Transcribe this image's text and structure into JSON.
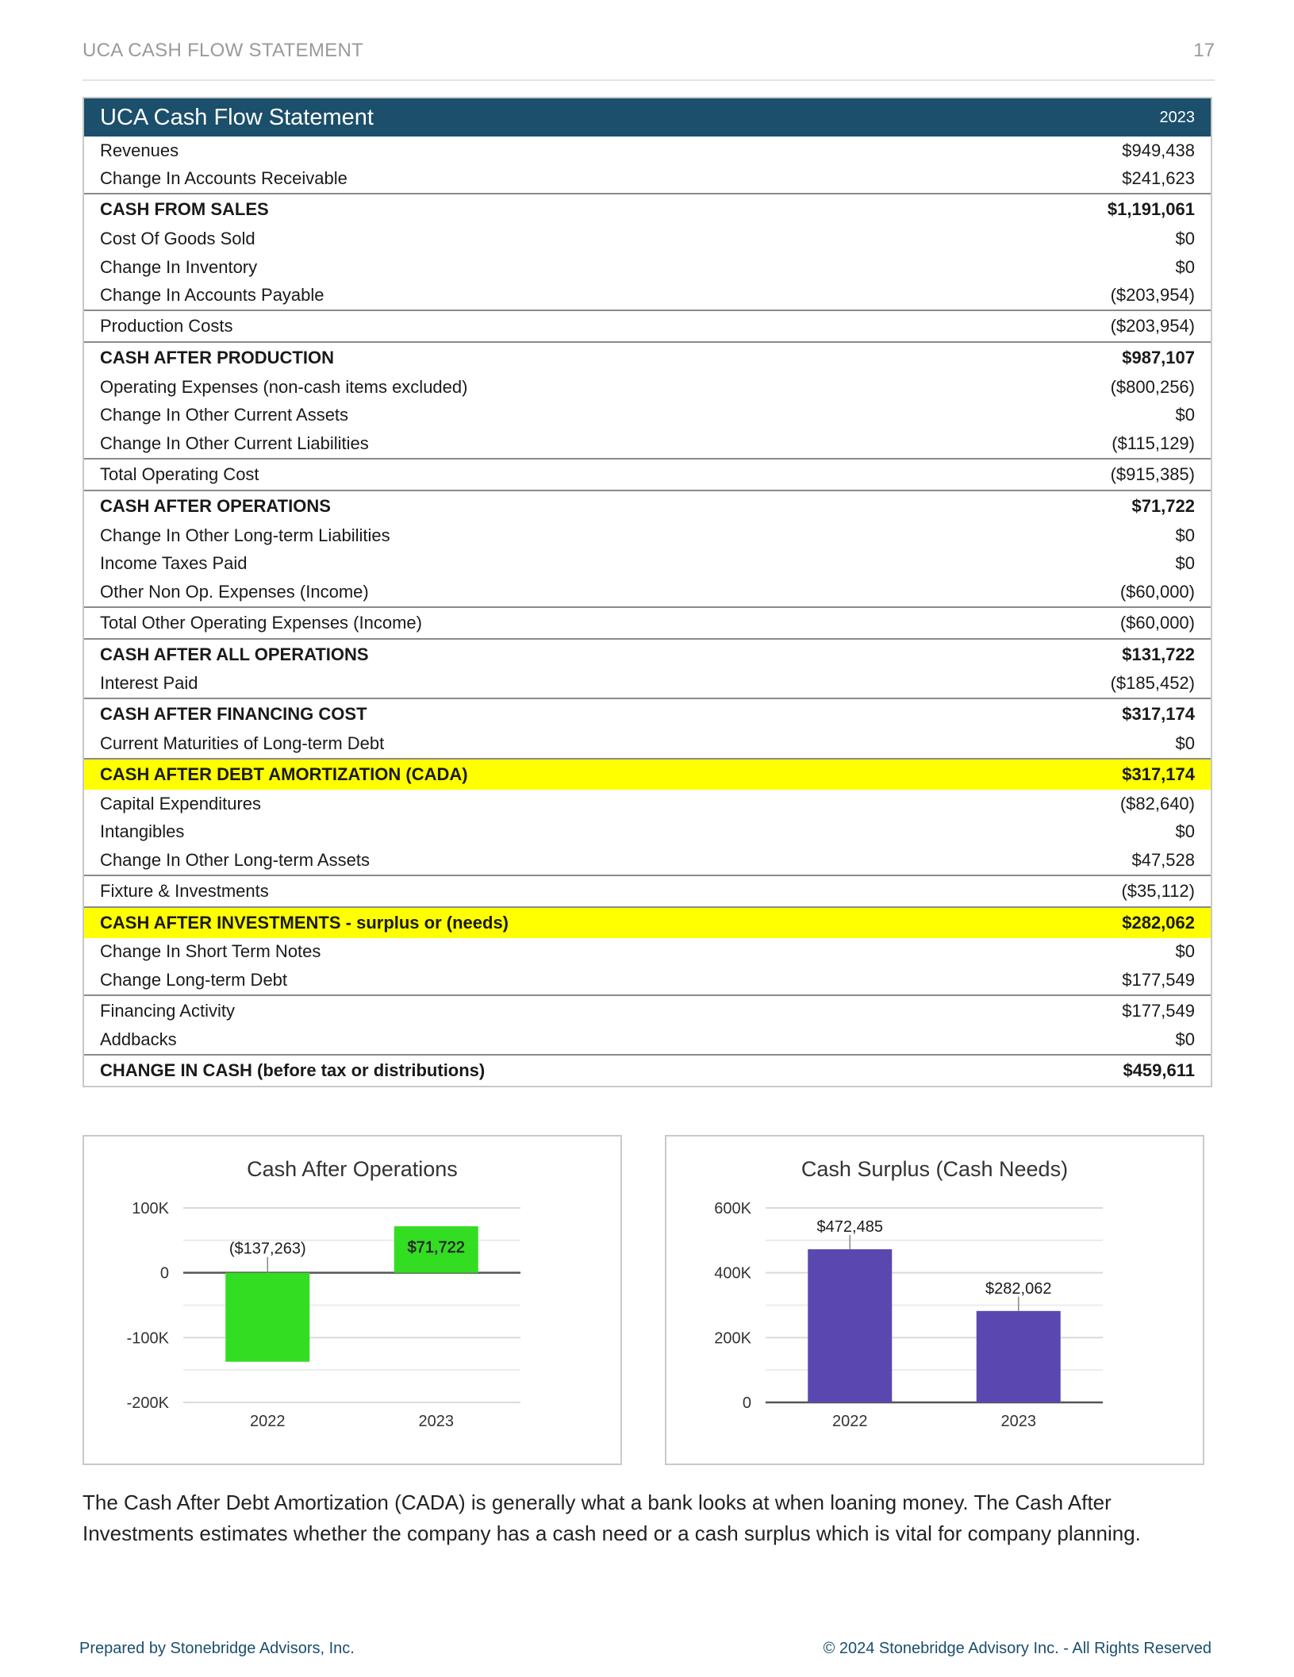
{
  "header": {
    "title": "UCA CASH FLOW STATEMENT",
    "page": "17"
  },
  "statement": {
    "title": "UCA Cash Flow Statement",
    "year": "2023",
    "rows": [
      {
        "label": "Revenues",
        "value": "$949,438",
        "style": ""
      },
      {
        "label": "Change In Accounts Receivable",
        "value": "$241,623",
        "style": ""
      },
      {
        "label": "CASH FROM SALES",
        "value": "$1,191,061",
        "style": "t b"
      },
      {
        "label": "Cost Of Goods Sold",
        "value": "$0",
        "style": ""
      },
      {
        "label": "Change In Inventory",
        "value": "$0",
        "style": ""
      },
      {
        "label": "Change In Accounts Payable",
        "value": "($203,954)",
        "style": ""
      },
      {
        "label": "Production Costs",
        "value": "($203,954)",
        "style": "t"
      },
      {
        "label": "CASH AFTER PRODUCTION",
        "value": "$987,107",
        "style": "t b"
      },
      {
        "label": "Operating Expenses (non-cash items excluded)",
        "value": "($800,256)",
        "style": ""
      },
      {
        "label": "Change In Other Current Assets",
        "value": "$0",
        "style": ""
      },
      {
        "label": "Change In Other Current Liabilities",
        "value": "($115,129)",
        "style": ""
      },
      {
        "label": "Total Operating Cost",
        "value": "($915,385)",
        "style": "t"
      },
      {
        "label": "CASH AFTER OPERATIONS",
        "value": "$71,722",
        "style": "t b"
      },
      {
        "label": "Change In Other Long-term Liabilities",
        "value": "$0",
        "style": ""
      },
      {
        "label": "Income Taxes Paid",
        "value": "$0",
        "style": ""
      },
      {
        "label": "Other Non Op. Expenses (Income)",
        "value": "($60,000)",
        "style": ""
      },
      {
        "label": "Total Other Operating Expenses (Income)",
        "value": "($60,000)",
        "style": "t"
      },
      {
        "label": "CASH AFTER ALL OPERATIONS",
        "value": "$131,722",
        "style": "t b"
      },
      {
        "label": "Interest Paid",
        "value": "($185,452)",
        "style": ""
      },
      {
        "label": "CASH AFTER FINANCING COST",
        "value": "$317,174",
        "style": "t b"
      },
      {
        "label": "Current Maturities of Long-term Debt",
        "value": "$0",
        "style": ""
      },
      {
        "label": "CASH AFTER DEBT AMORTIZATION (CADA)",
        "value": "$317,174",
        "style": "t b hl"
      },
      {
        "label": "Capital Expenditures",
        "value": "($82,640)",
        "style": ""
      },
      {
        "label": "Intangibles",
        "value": "$0",
        "style": ""
      },
      {
        "label": "Change In Other Long-term Assets",
        "value": "$47,528",
        "style": ""
      },
      {
        "label": "Fixture & Investments",
        "value": "($35,112)",
        "style": "t"
      },
      {
        "label": "CASH AFTER INVESTMENTS - surplus or (needs)",
        "value": "$282,062",
        "style": "t b hl"
      },
      {
        "label": "Change In Short Term Notes",
        "value": "$0",
        "style": ""
      },
      {
        "label": "Change Long-term Debt",
        "value": "$177,549",
        "style": ""
      },
      {
        "label": "Financing Activity",
        "value": "$177,549",
        "style": "t"
      },
      {
        "label": "Addbacks",
        "value": "$0",
        "style": ""
      },
      {
        "label": "CHANGE IN CASH (before tax or distributions)",
        "value": "$459,611",
        "style": "t b"
      }
    ]
  },
  "chart_data": [
    {
      "type": "bar",
      "title": "Cash After Operations",
      "categories": [
        "2022",
        "2023"
      ],
      "values": [
        -137263,
        71722
      ],
      "data_labels": [
        "($137,263)",
        "$71,722"
      ],
      "ylim": [
        -200000,
        100000
      ],
      "ticks": [
        100000,
        0,
        -100000,
        -200000
      ],
      "tick_labels": [
        "100K",
        "0",
        "-100K",
        "-200K"
      ],
      "minor_ticks": [
        50000,
        -50000,
        -150000
      ],
      "color": "#33dd22",
      "grid": true
    },
    {
      "type": "bar",
      "title": "Cash Surplus (Cash Needs)",
      "categories": [
        "2022",
        "2023"
      ],
      "values": [
        472485,
        282062
      ],
      "data_labels": [
        "$472,485",
        "$282,062"
      ],
      "ylim": [
        0,
        600000
      ],
      "ticks": [
        600000,
        400000,
        200000,
        0
      ],
      "tick_labels": [
        "600K",
        "400K",
        "200K",
        "0"
      ],
      "minor_ticks": [
        500000,
        300000,
        100000
      ],
      "color": "#5b47b0",
      "grid": true
    }
  ],
  "paragraph": "The Cash After Debt Amortization (CADA) is generally what a bank looks at when loaning money. The Cash After Investments estimates whether the company has a cash need or a cash surplus which is vital for company planning.",
  "footer": {
    "left": "Prepared by Stonebridge Advisors, Inc.",
    "right": "© 2024 Stonebridge Advisory Inc. - All Rights Reserved"
  }
}
